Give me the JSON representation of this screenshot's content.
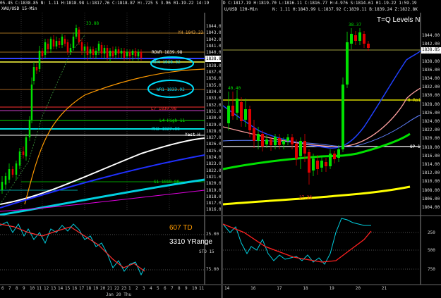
{
  "left_chart": {
    "header": "05.45  C:1838.85  N: 1.11  H:1818.98  L:1817.76  C:1818.87  H:.725  S 3.96  01-19-22  14:19",
    "symbol": "XAU/USD 15-Min",
    "price_scale": [
      "1844.00",
      "1843.00",
      "1842.00",
      "1841.00",
      "1840.00",
      "1839.00",
      "1838.00",
      "1837.00",
      "1836.00",
      "1835.00",
      "1834.00",
      "1833.00",
      "1832.00",
      "1831.00",
      "1830.00",
      "1829.00",
      "1828.00",
      "1827.00",
      "1826.00",
      "1825.00",
      "1824.00",
      "1823.00",
      "1822.00",
      "1821.00",
      "1820.00",
      "1819.00",
      "1818.00",
      "1817.00",
      "1816.00"
    ],
    "current_price_tag": "1838.85",
    "level_labels": {
      "yh": "YH 1843.23",
      "top_peak": "33.88",
      "rovr": "ROVR  1839.98",
      "wh4": "WH4 1838.32",
      "wr1": "WR1 1833.92",
      "l7": "L7 1830.08",
      "l4": "L4 High 11",
      "mh3": "MH3 1827.88",
      "yest_h": "Yest H",
      "s1": "S1 1818.88"
    },
    "text_overlays": {
      "td": "607 TD",
      "yrange": "3310 YRange",
      "sto": "STO 15"
    },
    "osc_scale": [
      "25.00",
      "75.00"
    ],
    "time_axis": [
      "6",
      "7",
      "8",
      "9",
      "10",
      "11",
      "12",
      "13",
      "14",
      "15",
      "16",
      "17",
      "18",
      "19",
      "20",
      "21",
      "22",
      "23",
      "1",
      "2",
      "3",
      "4",
      "5",
      "6",
      "7",
      "8",
      "9",
      "10",
      "11"
    ],
    "date_label": "Jan 20 Thu"
  },
  "right_chart": {
    "header": "D  C:1817.19  H:1819.70  L:1816.11  C:1816.77  H:4.976  S:1814.61  01-19-22  1:59.19",
    "symbol": "U/USD 120-Min",
    "sub_header": "N: 1.11  H:1843.99  L:1837.92  C:1839.11  B:1839.24  Z:1822.8K",
    "title": "T=Q Levels N",
    "price_scale": [
      "1844.00",
      "1842.00",
      "1840.00",
      "1838.00",
      "1836.00",
      "1834.00",
      "1832.00",
      "1830.00",
      "1828.00",
      "1826.00",
      "1824.00",
      "1822.00",
      "1820.00",
      "1818.00",
      "1816.00",
      "1814.00",
      "1812.00",
      "1810.00",
      "1808.00",
      "1806.00",
      "1804.00"
    ],
    "current_price_tag": "1838.85",
    "level_labels": {
      "top_peak": "38.37",
      "left_peak": "40.40",
      "q_roi": "0 Roi",
      "op": "OP 1",
      "bottom": "27.36"
    },
    "osc_scale": [
      "250",
      "500",
      "750"
    ],
    "time_axis": [
      "14",
      "16",
      "17",
      "18",
      "19",
      "20",
      "21"
    ]
  },
  "colors": {
    "up_candle": "#00e000",
    "down_candle": "#e00000",
    "yellow": "#ffff00",
    "cyan": "#00e0ff",
    "orange": "#ff9a00",
    "magenta": "#ff00ff",
    "blue": "#2030ff",
    "white": "#ffffff",
    "green_line": "#00dd00"
  }
}
